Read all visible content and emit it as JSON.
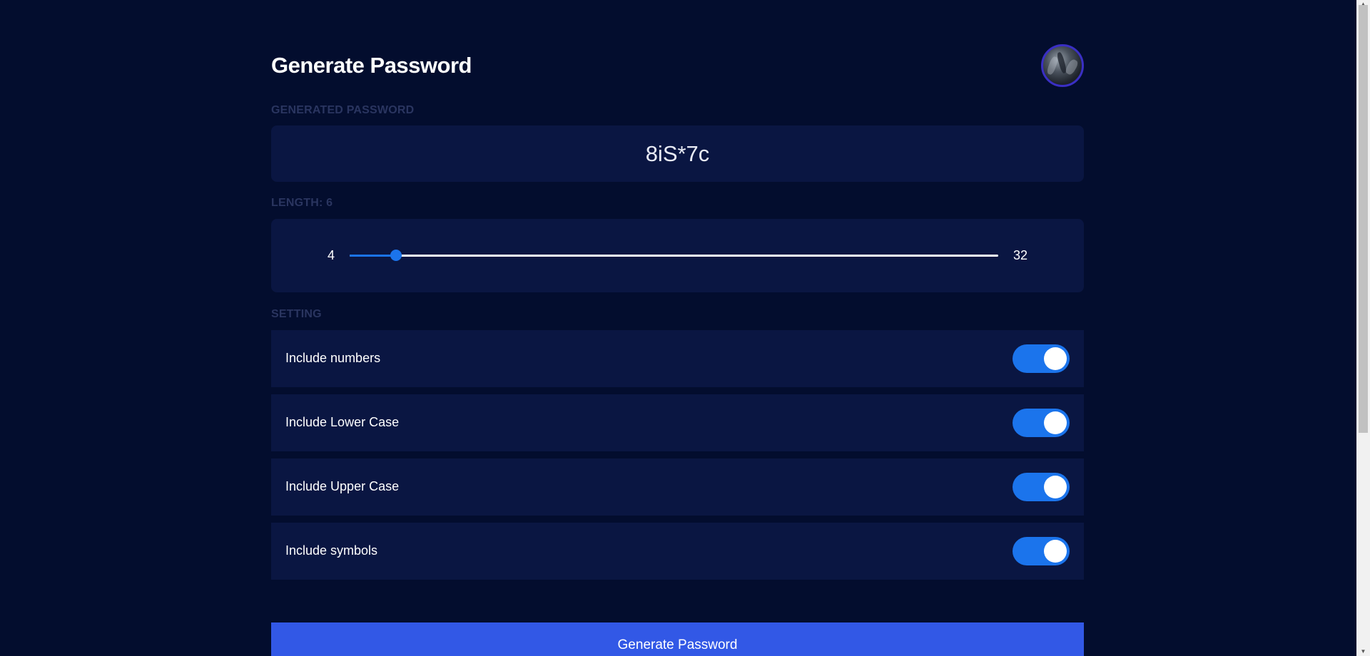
{
  "header": {
    "title": "Generate Password",
    "avatar_icon": "avatar-icon"
  },
  "password": {
    "section_label": "GENERATED PASSWORD",
    "value": "8iS*7c"
  },
  "length": {
    "section_label": "LENGTH: 6",
    "min_label": "4",
    "max_label": "32",
    "min": 4,
    "max": 32,
    "value": 6
  },
  "settings": {
    "section_label": "SETTING",
    "items": [
      {
        "label": "Include numbers",
        "enabled": true
      },
      {
        "label": "Include Lower Case",
        "enabled": true
      },
      {
        "label": "Include Upper Case",
        "enabled": true
      },
      {
        "label": "Include symbols",
        "enabled": true
      }
    ]
  },
  "generate_button": {
    "label": "Generate Password"
  },
  "colors": {
    "background": "#030d2e",
    "panel": "#0a1642",
    "accent": "#1b74ec",
    "button": "#3258e6",
    "section_label": "#2a3560"
  }
}
